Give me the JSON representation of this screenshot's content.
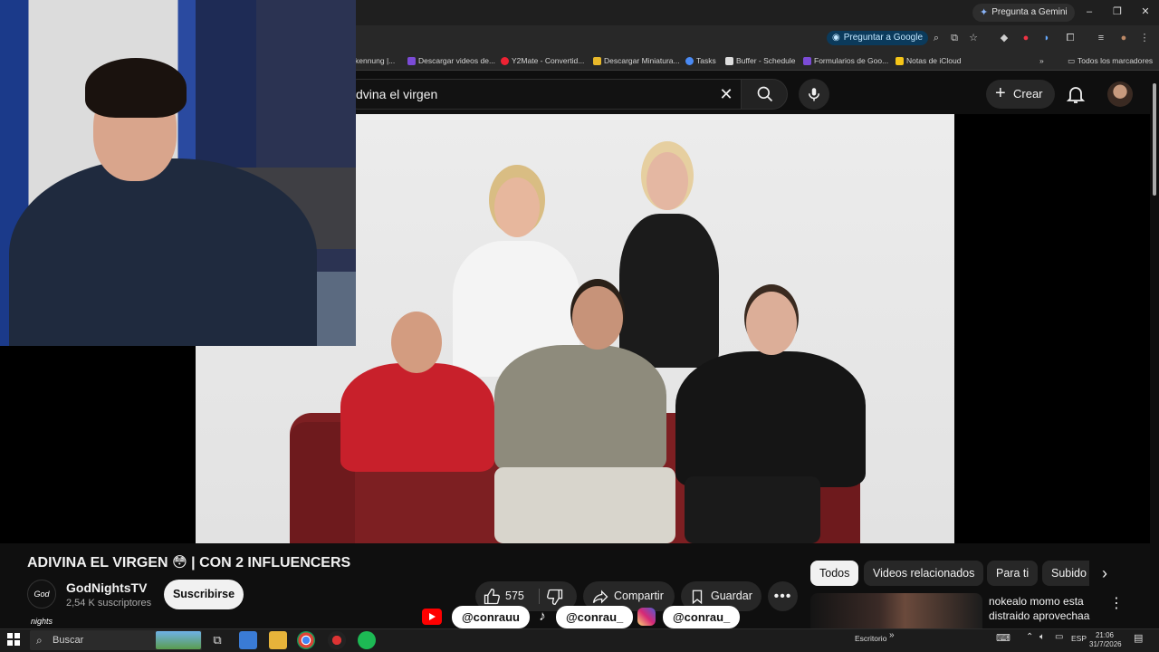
{
  "browser": {
    "gemini_label": "Pregunta a Gemini",
    "google_pill": "Preguntar a Google",
    "bookmarks": [
      "kennung |...",
      "Descargar videos de...",
      "Y2Mate - Convertid...",
      "Descargar Miniatura...",
      "Tasks",
      "Buffer - Schedule",
      "Formularios de Goo...",
      "Notas de iCloud"
    ],
    "bookmarks_overflow": "»",
    "all_bookmarks": "Todos los marcadores"
  },
  "youtube": {
    "search_value": "dvina el virgen",
    "create_label": "Crear",
    "video_title": "ADIVINA EL VIRGEN 😳 | CON 2 INFLUENCERS",
    "channel_name": "GodNightsTV",
    "channel_subs": "2,54 K suscriptores",
    "channel_avatar_text": "God nights",
    "subscribe_label": "Suscribirse",
    "like_count": "575",
    "share_label": "Compartir",
    "save_label": "Guardar",
    "chips": [
      "Todos",
      "Videos relacionados",
      "Para ti",
      "Subido"
    ],
    "related_title": "nokealo momo esta distraido aprovechaa",
    "socials": [
      "@conrauu",
      "@conrau_",
      "@conrau_"
    ]
  },
  "taskbar": {
    "search_placeholder": "Buscar",
    "desktop_label": "Escritorio",
    "lang": "ESP",
    "time": "21:06",
    "date": "31/7/2026"
  },
  "colors": {
    "yt_bg": "#0f0f0f",
    "chip_bg": "#272727",
    "youtube_red": "#ff0000",
    "instagram": "#d6249f"
  }
}
